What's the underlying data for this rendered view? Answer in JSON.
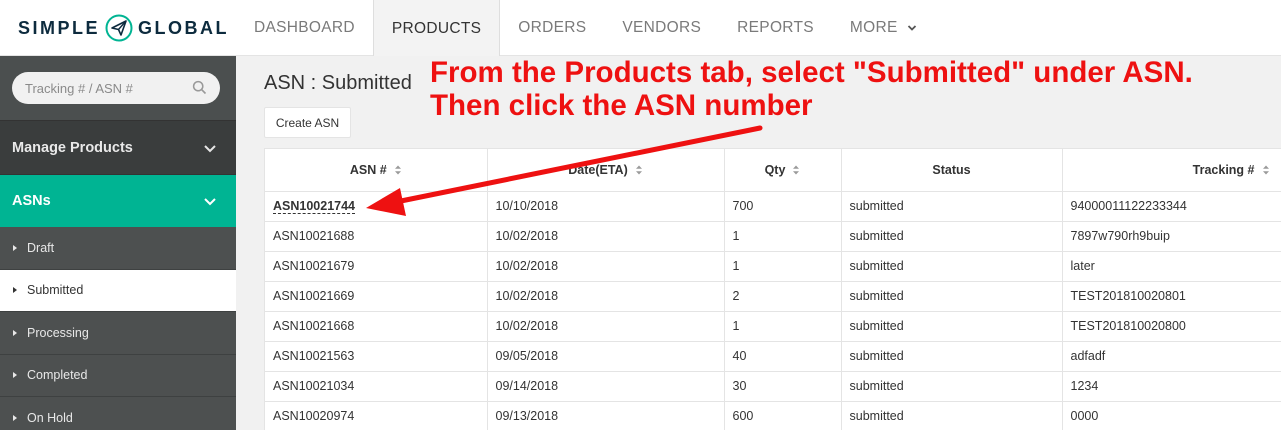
{
  "brand": {
    "word_left": "SIMPLE",
    "word_right": "GLOBAL",
    "accent": "#00b493"
  },
  "nav": {
    "tabs": [
      {
        "label": "DASHBOARD",
        "active": false
      },
      {
        "label": "PRODUCTS",
        "active": true
      },
      {
        "label": "ORDERS",
        "active": false
      },
      {
        "label": "VENDORS",
        "active": false
      },
      {
        "label": "REPORTS",
        "active": false
      },
      {
        "label": "MORE",
        "active": false
      }
    ]
  },
  "sidebar": {
    "search": {
      "placeholder": "Tracking # / ASN #"
    },
    "sections": [
      {
        "label": "Manage Products",
        "icon": "chevron-down-icon"
      },
      {
        "label": "ASNs",
        "icon": "chevron-down-icon",
        "active": true
      }
    ],
    "items": [
      {
        "label": "Draft",
        "active": false
      },
      {
        "label": "Submitted",
        "active": true
      },
      {
        "label": "Processing",
        "active": false
      },
      {
        "label": "Completed",
        "active": false
      },
      {
        "label": "On Hold",
        "active": false
      }
    ]
  },
  "main": {
    "title": "ASN : Submitted",
    "create_button": "Create ASN",
    "annotation": "From the Products tab, select \"Submitted\" under ASN. Then click the ASN number",
    "annotation_color": "#ee1111",
    "table": {
      "headers": [
        "ASN #",
        "Date(ETA)",
        "Qty",
        "Status",
        "Tracking #"
      ],
      "rows": [
        [
          "ASN10021744",
          "10/10/2018",
          "700",
          "submitted",
          "94000011122233344"
        ],
        [
          "ASN10021688",
          "10/02/2018",
          "1",
          "submitted",
          "7897w790rh9buip"
        ],
        [
          "ASN10021679",
          "10/02/2018",
          "1",
          "submitted",
          "later"
        ],
        [
          "ASN10021669",
          "10/02/2018",
          "2",
          "submitted",
          "TEST201810020801"
        ],
        [
          "ASN10021668",
          "10/02/2018",
          "1",
          "submitted",
          "TEST201810020800"
        ],
        [
          "ASN10021563",
          "09/05/2018",
          "40",
          "submitted",
          "adfadf"
        ],
        [
          "ASN10021034",
          "09/14/2018",
          "30",
          "submitted",
          "1234"
        ],
        [
          "ASN10020974",
          "09/13/2018",
          "600",
          "submitted",
          "0000"
        ]
      ]
    }
  }
}
